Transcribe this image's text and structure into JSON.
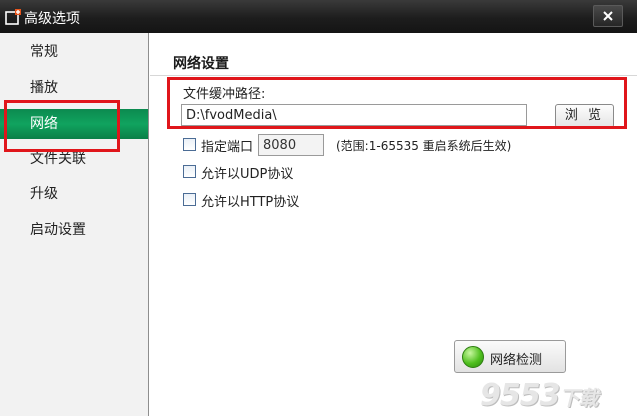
{
  "window": {
    "title": "高级选项",
    "close_icon": "close-icon"
  },
  "sidebar": {
    "items": [
      {
        "label": "常规"
      },
      {
        "label": "播放"
      },
      {
        "label": "网络",
        "active": true
      },
      {
        "label": "文件关联"
      },
      {
        "label": "升级"
      },
      {
        "label": "启动设置"
      }
    ]
  },
  "network": {
    "section_title": "网络设置",
    "cache_path_label": "文件缓冲路径:",
    "cache_path_value": "D:\\fvodMedia\\",
    "browse_label": "浏 览",
    "port_option_label": "指定端口",
    "port_value": "8080",
    "port_range_note": "(范围:1-65535 重启系统后生效)",
    "udp_option_label": "允许以UDP协议",
    "http_option_label": "允许以HTTP协议",
    "check_button_label": "网络检测"
  },
  "watermark": {
    "number": "9553",
    "suffix": "下载"
  },
  "colors": {
    "accent_green": "#10a35f",
    "highlight_red": "#e0161b",
    "titlebar": "#1d1d1d"
  }
}
